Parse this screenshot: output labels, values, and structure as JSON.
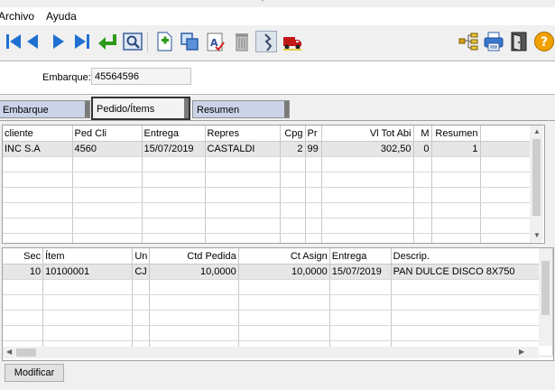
{
  "menu": [
    "Archivo",
    "Ayuda"
  ],
  "title_fragment": "'",
  "toolbar": {
    "left": [
      "first-record-icon",
      "prev-record-icon",
      "next-record-icon",
      "last-record-icon",
      "undo-arrow-icon",
      "preview-icon",
      "new-document-icon",
      "copy-windows-icon",
      "spell-check-icon",
      "trash-icon",
      "lightning-icon",
      "truck-icon"
    ],
    "right": [
      "tree-icon",
      "printer-icon",
      "exit-door-icon",
      "help-icon"
    ]
  },
  "header": {
    "embarque_label": "Embarque:",
    "embarque_value": "45564596"
  },
  "tabs": [
    "Embarque",
    "Pedido/Ítems",
    "Resumen"
  ],
  "orders_grid": {
    "columns": [
      "cliente",
      "Ped Cli",
      "Entrega",
      "Repres",
      "Cpg",
      "Pr",
      "Vl Tot Abi",
      "M",
      "Resumen"
    ],
    "rows": [
      [
        "INC  S.A",
        "4560",
        "15/07/2019",
        "CASTALDI",
        "2",
        "99",
        "302,50",
        "0",
        "1"
      ]
    ]
  },
  "items_grid": {
    "columns": [
      "Sec",
      "Ítem",
      "Un",
      "Ctd Pedida",
      "Ct Asign",
      "Entrega",
      "Descrip."
    ],
    "rows": [
      [
        "10",
        "10100001",
        "CJ",
        "10,0000",
        "10,0000",
        "15/07/2019",
        "PAN DULCE DISCO 8X750"
      ]
    ]
  },
  "buttons": {
    "modify": "Modificar"
  },
  "colors": {
    "accent": "#1f6fd1",
    "tab_inactive": "#ccd3e8",
    "selected_row": "#e6e6e6"
  }
}
